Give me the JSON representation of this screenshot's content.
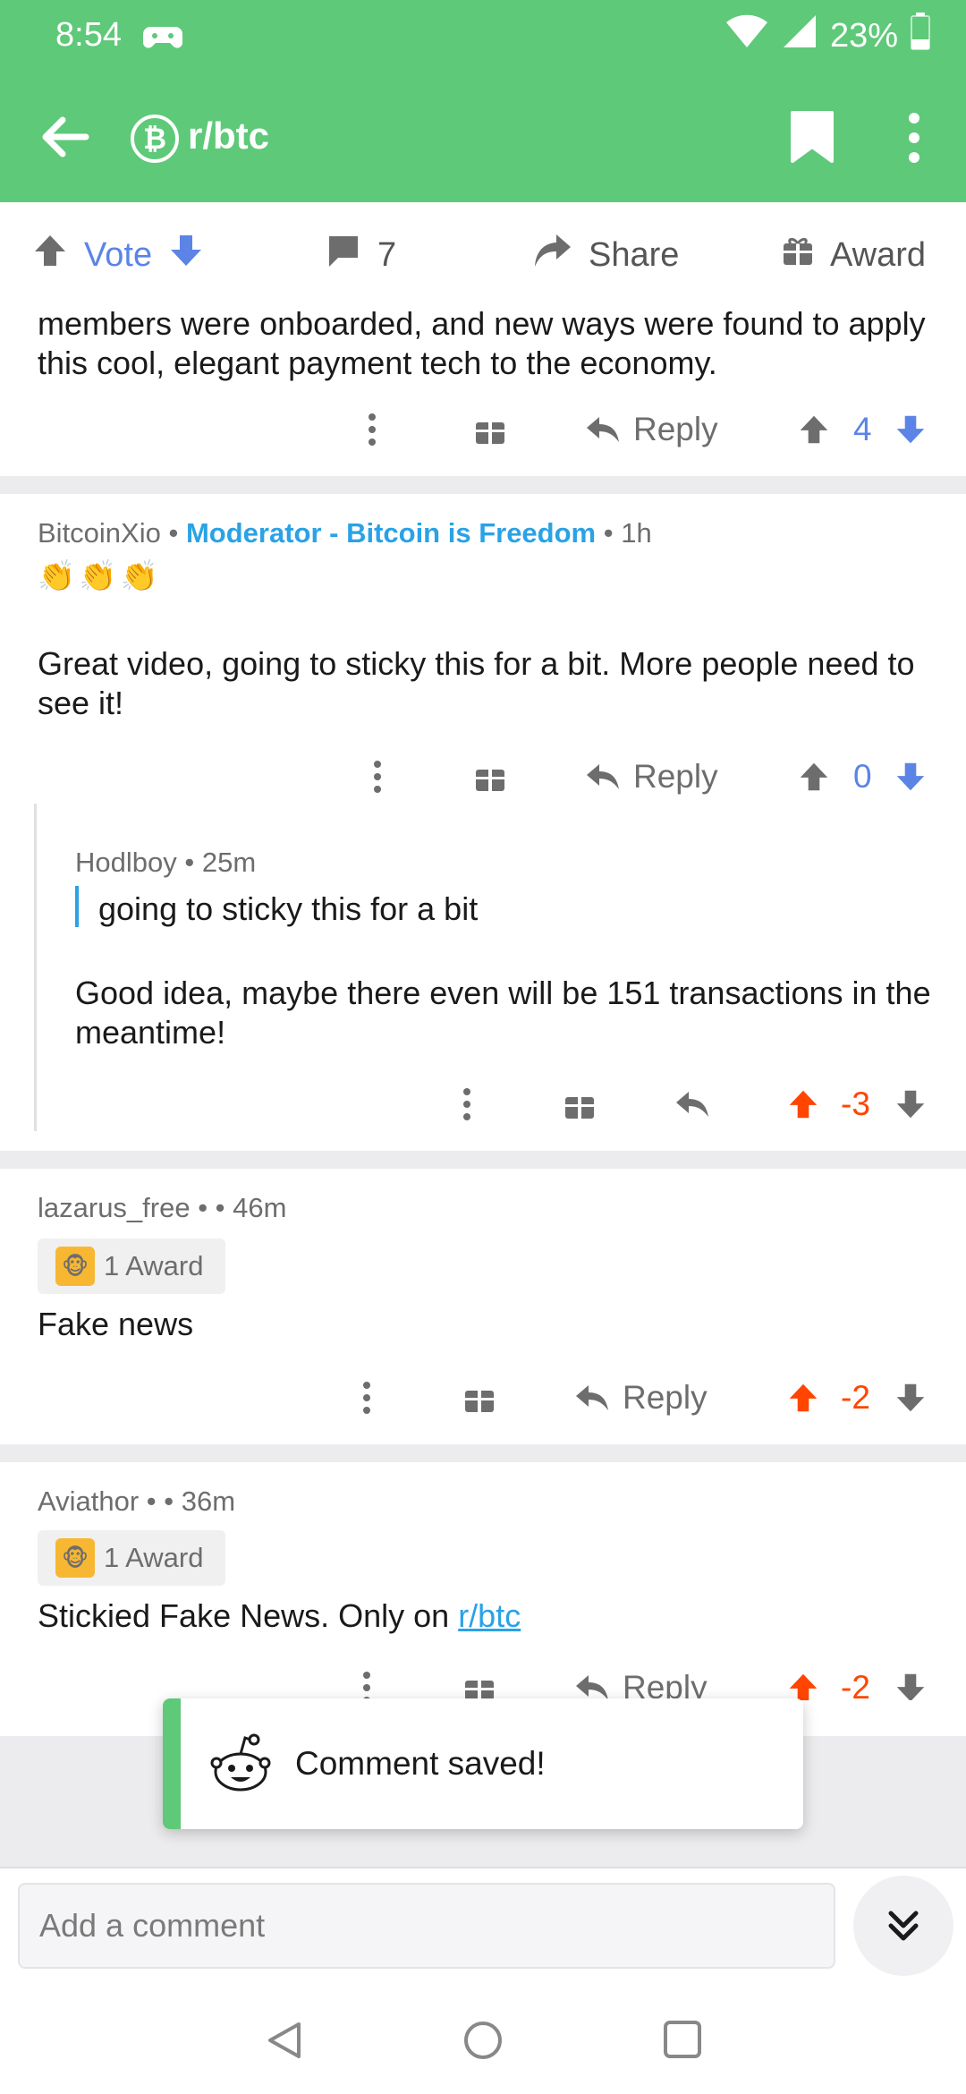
{
  "status_bar": {
    "time": "8:54",
    "battery": "23%"
  },
  "header": {
    "subreddit": "r/btc",
    "sub_icon": "bitcoin-icon"
  },
  "post_bar": {
    "vote_label": "Vote",
    "comments_count": "7",
    "share_label": "Share",
    "award_label": "Award"
  },
  "truncated_comment": {
    "text": "members were onboarded, and new ways were found to apply this cool, elegant payment tech to the economy.",
    "reply_label": "Reply",
    "score": "4"
  },
  "comments": [
    {
      "author": "BitcoinXio",
      "flair": "Moderator - Bitcoin is Freedom",
      "time": "1h",
      "emojis": "👏👏👏",
      "text": "Great video, going to sticky this for a bit. More people need to see it!",
      "reply_label": "Reply",
      "score": "0"
    },
    {
      "author": "Hodlboy",
      "time": "25m",
      "quote": "going to sticky this for a bit",
      "text": "Good idea, maybe there even will be 151 transactions in the meantime!",
      "score": "-3"
    },
    {
      "author": "lazarus_free",
      "time": "46m",
      "award": "1 Award",
      "text": "Fake news",
      "reply_label": "Reply",
      "score": "-2"
    },
    {
      "author": "Aviathor",
      "time": "36m",
      "award": "1 Award",
      "text_prefix": "Stickied Fake News. Only on ",
      "link": "r/btc",
      "reply_label": "Reply",
      "score": "-2"
    }
  ],
  "toast": {
    "message": "Comment saved!"
  },
  "composer": {
    "placeholder": "Add a comment"
  },
  "colors": {
    "brand": "#5ec978",
    "upvote": "#ff4500",
    "vote_blue": "#5b84e6",
    "mod_flair": "#2aa2e6"
  }
}
